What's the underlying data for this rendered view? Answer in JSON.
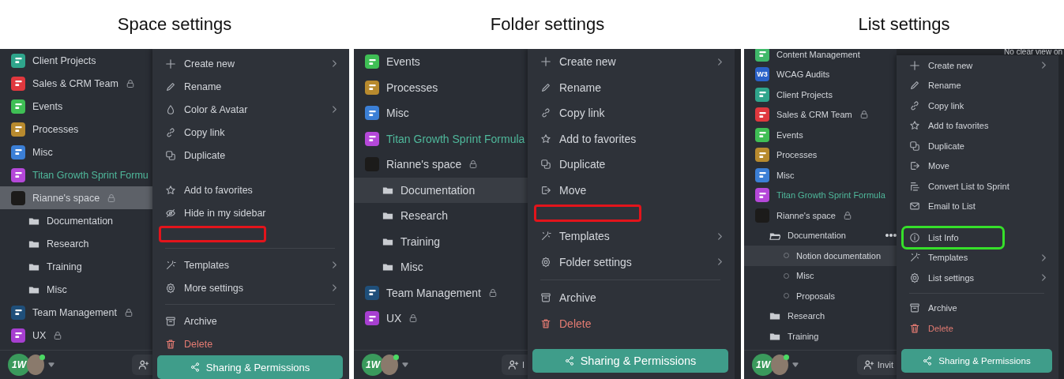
{
  "panels": [
    {
      "title": "Space settings",
      "sidebar": {
        "items": [
          {
            "kind": "space",
            "label": "Client Projects",
            "color": "#2fa58c",
            "locked": false,
            "active": false,
            "selected": false
          },
          {
            "kind": "space",
            "label": "Sales & CRM Team",
            "color": "#e0383e",
            "locked": true,
            "active": false,
            "selected": false
          },
          {
            "kind": "space",
            "label": "Events",
            "color": "#3fbf55",
            "locked": false,
            "active": false,
            "selected": false
          },
          {
            "kind": "space",
            "label": "Processes",
            "color": "#b88a2e",
            "locked": false,
            "active": false,
            "selected": false
          },
          {
            "kind": "space",
            "label": "Misc",
            "color": "#3b7fd6",
            "locked": false,
            "active": false,
            "selected": false
          },
          {
            "kind": "space",
            "label": "Titan Growth Sprint Formu",
            "color": "#b548d9",
            "locked": false,
            "active": true,
            "selected": false
          },
          {
            "kind": "avatar",
            "label": "Rianne's space",
            "locked": true,
            "active": false,
            "selected": true,
            "children": [
              {
                "kind": "folder",
                "label": "Documentation",
                "expanded": false,
                "selected": false
              },
              {
                "kind": "folder",
                "label": "Research",
                "expanded": false,
                "selected": false
              },
              {
                "kind": "folder",
                "label": "Training",
                "expanded": false,
                "selected": false
              },
              {
                "kind": "folder",
                "label": "Misc",
                "expanded": false,
                "selected": false
              }
            ]
          },
          {
            "kind": "space",
            "label": "Team Management",
            "color": "#1f4f7a",
            "locked": true,
            "active": false,
            "selected": false
          },
          {
            "kind": "space",
            "label": "UX",
            "color": "#a73fd1",
            "locked": true,
            "active": false,
            "selected": false
          }
        ]
      },
      "footer": {
        "logo_text": "1W"
      },
      "menu": {
        "items": [
          {
            "kind": "submenu",
            "label": "Create new"
          },
          {
            "kind": "item",
            "label": "Rename"
          },
          {
            "kind": "submenu",
            "label": "Color & Avatar"
          },
          {
            "kind": "item",
            "label": "Copy link"
          },
          {
            "kind": "item",
            "label": "Duplicate"
          },
          {
            "kind": "gap"
          },
          {
            "kind": "item",
            "label": "Add to favorites"
          },
          {
            "kind": "item",
            "label": "Hide in my sidebar"
          },
          {
            "kind": "gap",
            "color": "#e3141b"
          },
          {
            "kind": "divider"
          },
          {
            "kind": "submenu",
            "label": "Templates"
          },
          {
            "kind": "submenu",
            "label": "More settings"
          },
          {
            "kind": "divider"
          },
          {
            "kind": "item",
            "label": "Archive"
          },
          {
            "kind": "danger",
            "label": "Delete"
          }
        ],
        "button": "Sharing & Permissions"
      }
    },
    {
      "title": "Folder settings",
      "sidebar": {
        "items": [
          {
            "kind": "space",
            "label": "Events",
            "color": "#3fbf55",
            "locked": false,
            "active": false,
            "selected": false
          },
          {
            "kind": "space",
            "label": "Processes",
            "color": "#b88a2e",
            "locked": false,
            "active": false,
            "selected": false
          },
          {
            "kind": "space",
            "label": "Misc",
            "color": "#3b7fd6",
            "locked": false,
            "active": false,
            "selected": false
          },
          {
            "kind": "space",
            "label": "Titan Growth Sprint Formula",
            "color": "#b548d9",
            "locked": false,
            "active": true,
            "selected": false
          },
          {
            "kind": "avatar",
            "label": "Rianne's space",
            "locked": true,
            "active": false,
            "selected": false,
            "children": [
              {
                "kind": "folder",
                "label": "Documentation",
                "expanded": false,
                "selected": true
              },
              {
                "kind": "folder",
                "label": "Research",
                "expanded": false,
                "selected": false
              },
              {
                "kind": "folder",
                "label": "Training",
                "expanded": false,
                "selected": false
              },
              {
                "kind": "folder",
                "label": "Misc",
                "expanded": false,
                "selected": false
              }
            ]
          },
          {
            "kind": "space",
            "label": "Team Management",
            "color": "#1f4f7a",
            "locked": true,
            "active": false,
            "selected": false
          },
          {
            "kind": "space",
            "label": "UX",
            "color": "#a73fd1",
            "locked": true,
            "active": false,
            "selected": false
          }
        ]
      },
      "footer": {
        "logo_text": "1W",
        "invite": "I"
      },
      "menu": {
        "items": [
          {
            "kind": "submenu",
            "label": "Create new"
          },
          {
            "kind": "item",
            "label": "Rename"
          },
          {
            "kind": "item",
            "label": "Copy link"
          },
          {
            "kind": "item",
            "label": "Add to favorites"
          },
          {
            "kind": "item",
            "label": "Duplicate"
          },
          {
            "kind": "item",
            "label": "Move"
          },
          {
            "kind": "gap",
            "color": "#e3141b"
          },
          {
            "kind": "submenu",
            "label": "Templates"
          },
          {
            "kind": "submenu",
            "label": "Folder settings"
          },
          {
            "kind": "divider"
          },
          {
            "kind": "item",
            "label": "Archive"
          },
          {
            "kind": "danger",
            "label": "Delete"
          }
        ],
        "button": "Sharing & Permissions"
      }
    },
    {
      "title": "List settings",
      "header_text": "No clear view on",
      "sidebar": {
        "items": [
          {
            "kind": "space",
            "label": "Content Management",
            "color": "#3fb96a",
            "locked": false,
            "active": false,
            "selected": false
          },
          {
            "kind": "space",
            "label": "WCAG Audits",
            "color": "#2a62c9",
            "icon_text": "W3",
            "locked": false,
            "active": false,
            "selected": false
          },
          {
            "kind": "space",
            "label": "Client Projects",
            "color": "#2fa58c",
            "locked": false,
            "active": false,
            "selected": false
          },
          {
            "kind": "space",
            "label": "Sales & CRM Team",
            "color": "#e0383e",
            "locked": true,
            "active": false,
            "selected": false
          },
          {
            "kind": "space",
            "label": "Events",
            "color": "#3fbf55",
            "locked": false,
            "active": false,
            "selected": false
          },
          {
            "kind": "space",
            "label": "Processes",
            "color": "#b88a2e",
            "locked": false,
            "active": false,
            "selected": false
          },
          {
            "kind": "space",
            "label": "Misc",
            "color": "#3b7fd6",
            "locked": false,
            "active": false,
            "selected": false
          },
          {
            "kind": "space",
            "label": "Titan Growth Sprint Formula",
            "color": "#b548d9",
            "locked": false,
            "active": true,
            "selected": false
          },
          {
            "kind": "avatar",
            "label": "Rianne's space",
            "locked": true,
            "active": false,
            "selected": false,
            "children": [
              {
                "kind": "folder",
                "label": "Documentation",
                "expanded": true,
                "selected": false,
                "more": true,
                "children": [
                  {
                    "kind": "list",
                    "label": "Notion documentation",
                    "selected": true
                  },
                  {
                    "kind": "list",
                    "label": "Misc",
                    "selected": false
                  },
                  {
                    "kind": "list",
                    "label": "Proposals",
                    "selected": false
                  }
                ]
              },
              {
                "kind": "folder",
                "label": "Research",
                "expanded": false,
                "selected": false
              },
              {
                "kind": "folder",
                "label": "Training",
                "expanded": false,
                "selected": false
              }
            ]
          }
        ]
      },
      "footer": {
        "logo_text": "1W",
        "invite": "Invit"
      },
      "menu": {
        "items": [
          {
            "kind": "submenu",
            "label": "Create new"
          },
          {
            "kind": "item",
            "label": "Rename"
          },
          {
            "kind": "item",
            "label": "Copy link"
          },
          {
            "kind": "item",
            "label": "Add to favorites"
          },
          {
            "kind": "item",
            "label": "Duplicate"
          },
          {
            "kind": "item",
            "label": "Move"
          },
          {
            "kind": "item",
            "label": "Convert List to Sprint"
          },
          {
            "kind": "item",
            "label": "Email to List"
          },
          {
            "kind": "gap"
          },
          {
            "kind": "item",
            "label": "List Info",
            "color": "#36e02a"
          },
          {
            "kind": "submenu",
            "label": "Templates"
          },
          {
            "kind": "submenu",
            "label": "List settings"
          },
          {
            "kind": "divider"
          },
          {
            "kind": "item",
            "label": "Archive"
          },
          {
            "kind": "danger",
            "label": "Delete"
          }
        ],
        "button": "Sharing & Permissions"
      }
    }
  ]
}
